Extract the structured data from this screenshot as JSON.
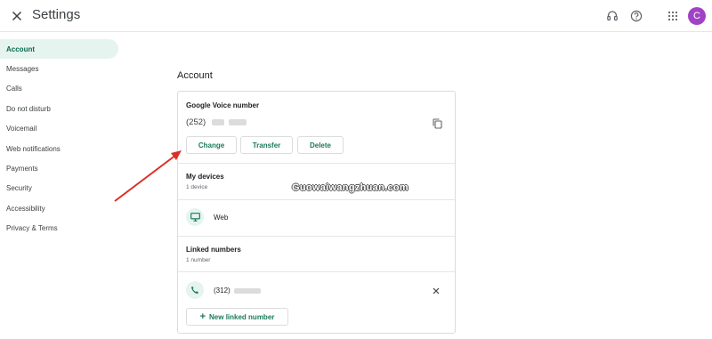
{
  "header": {
    "title": "Settings",
    "avatar_letter": "C",
    "icons": [
      "close-icon",
      "headset-icon",
      "help-icon",
      "apps-grid-icon"
    ]
  },
  "sidebar": {
    "items": [
      {
        "label": "Account",
        "active": true
      },
      {
        "label": "Messages"
      },
      {
        "label": "Calls"
      },
      {
        "label": "Do not disturb"
      },
      {
        "label": "Voicemail"
      },
      {
        "label": "Web notifications"
      },
      {
        "label": "Payments"
      },
      {
        "label": "Security"
      },
      {
        "label": "Accessibility"
      },
      {
        "label": "Privacy & Terms"
      }
    ]
  },
  "main": {
    "section_title": "Account",
    "voice_number": {
      "label": "Google Voice number",
      "number_prefix": "(252)",
      "buttons": {
        "change": "Change",
        "transfer": "Transfer",
        "delete": "Delete"
      }
    },
    "devices": {
      "label": "My devices",
      "count": "1 device",
      "items": [
        {
          "name": "Web"
        }
      ]
    },
    "linked": {
      "label": "Linked numbers",
      "count": "1 number",
      "number_prefix": "(312)",
      "add_label": "New linked number"
    }
  },
  "watermark": "Guowaiwangzhuan.com",
  "colors": {
    "accent": "#1a7a5a",
    "active_bg": "#e6f4ef",
    "avatar": "#a142c5",
    "arrow": "#d93025"
  }
}
